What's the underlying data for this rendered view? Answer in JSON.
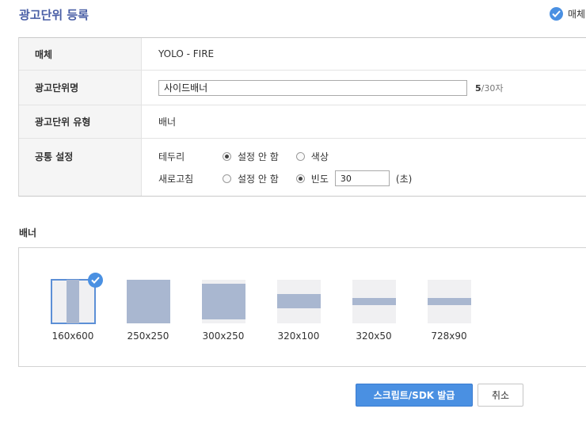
{
  "page": {
    "title": "광고단위 등록"
  },
  "top_right": {
    "label": "매체",
    "icon": "check-circle-icon"
  },
  "form": {
    "media": {
      "label": "매체",
      "value": "YOLO - FIRE"
    },
    "unit_name": {
      "label": "광고단위명",
      "value": "사이드배너",
      "count": "5",
      "max": "/30자"
    },
    "unit_type": {
      "label": "광고단위 유형",
      "value": "배너"
    },
    "common": {
      "label": "공통 설정",
      "border": {
        "label": "테두리",
        "options": [
          "설정 안 함",
          "색상"
        ],
        "selected": "설정 안 함"
      },
      "refresh": {
        "label": "새로고침",
        "options": [
          "설정 안 함",
          "빈도"
        ],
        "selected": "빈도",
        "value": "30",
        "unit": "(초)"
      }
    }
  },
  "banner": {
    "title": "배너",
    "sizes": [
      {
        "label": "160x600",
        "selected": true
      },
      {
        "label": "250x250",
        "selected": false
      },
      {
        "label": "300x250",
        "selected": false
      },
      {
        "label": "320x100",
        "selected": false
      },
      {
        "label": "320x50",
        "selected": false
      },
      {
        "label": "728x90",
        "selected": false
      }
    ]
  },
  "buttons": {
    "issue": "스크립트/SDK 발급",
    "cancel": "취소"
  },
  "colors": {
    "accent": "#4a90e2",
    "title": "#4a5fa6",
    "thumb_fill": "#a9b7d0"
  }
}
